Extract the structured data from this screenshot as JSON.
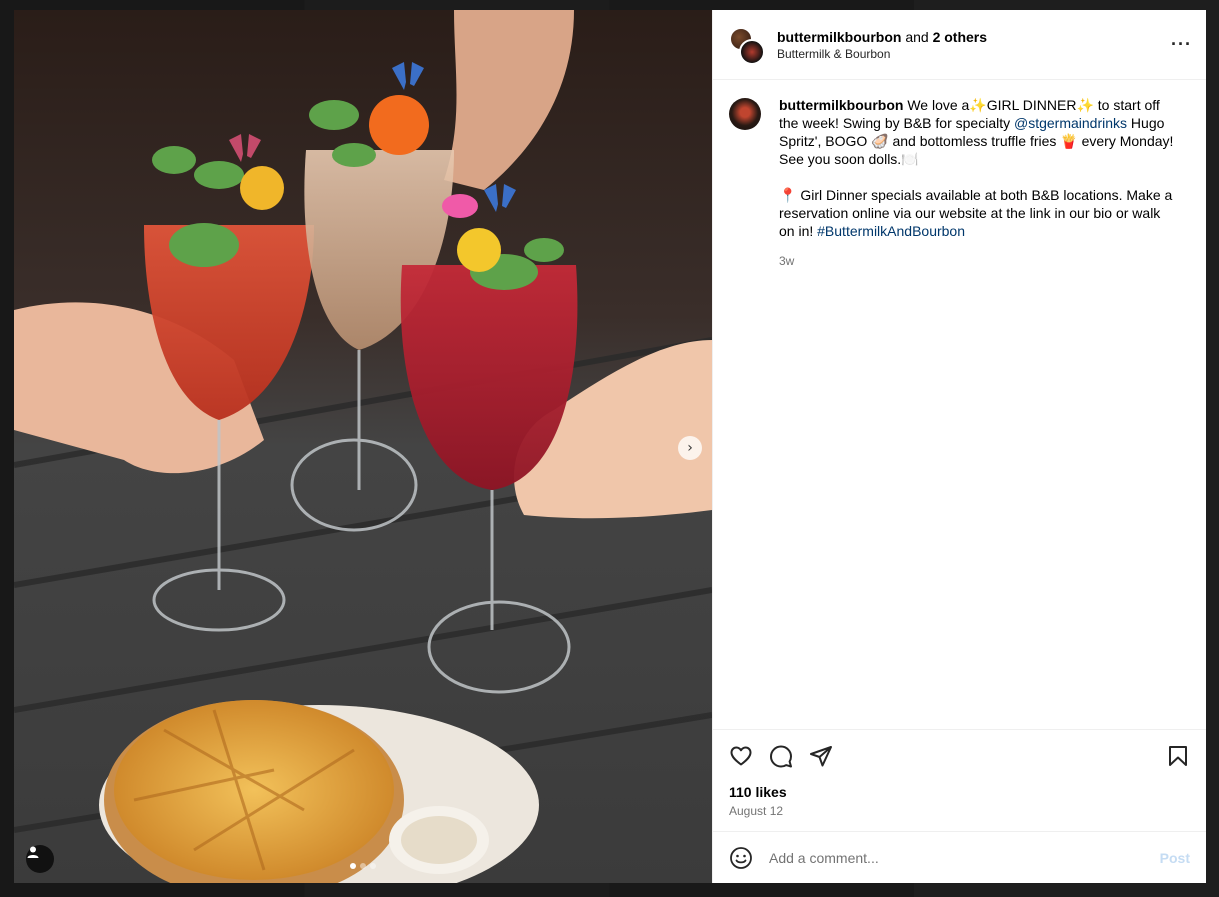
{
  "header": {
    "username": "buttermilkbourbon",
    "connector": "and",
    "others": "2 others",
    "location": "Buttermilk & Bourbon"
  },
  "caption": {
    "username": "buttermilkbourbon",
    "text_1": "We love a✨GIRL DINNER✨ to start off the week! Swing by B&B for specialty",
    "mention": "@stgermaindrinks",
    "text_2": "Hugo Spritz', BOGO 🦪 and bottomless truffle fries 🍟 every Monday! See you soon dolls.🍽️",
    "text_3": "📍 Girl Dinner specials available at both B&B locations. Make a reservation online via our website at the link in our bio or walk on in!",
    "hashtag": "#ButtermilkAndBourbon",
    "time": "3w"
  },
  "stats": {
    "likes": "110 likes",
    "date": "August 12"
  },
  "comment": {
    "placeholder": "Add a comment...",
    "post_label": "Post"
  },
  "media": {
    "next_glyph": "›",
    "slide_count": 3,
    "active_slide": 1
  },
  "colors": {
    "link": "#00376b",
    "muted": "#737373",
    "post_disabled": "#c5dcf3"
  }
}
